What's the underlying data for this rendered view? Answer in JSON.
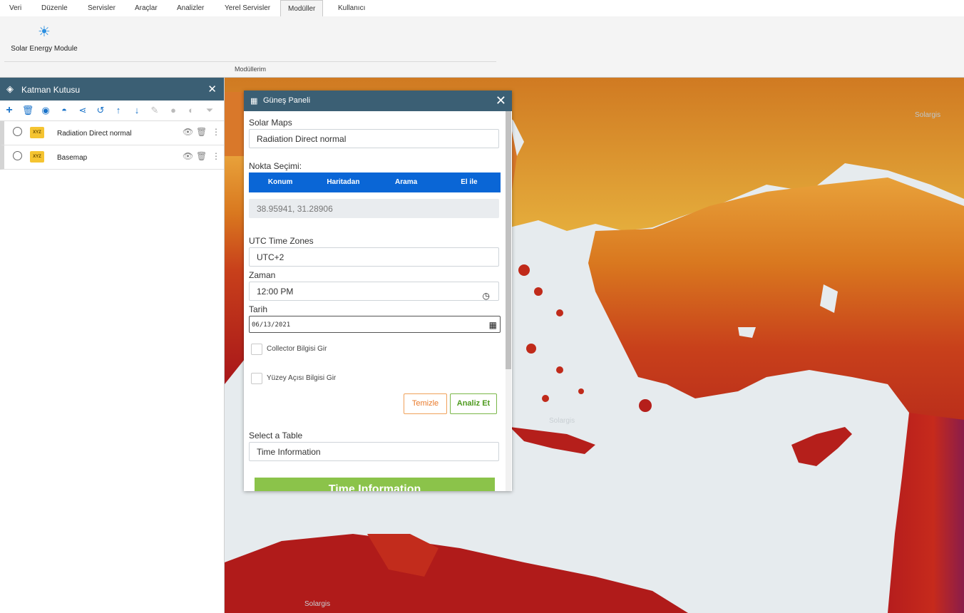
{
  "ribbon": {
    "tabs": [
      "Veri",
      "Düzenle",
      "Servisler",
      "Araçlar",
      "Analizler",
      "Yerel Servisler",
      "Modüller",
      "Kullanıcı"
    ],
    "active_tab": "Modüller",
    "module_button": {
      "icon": "sun-icon",
      "label": "Solar Energy Module"
    },
    "group_label": "Modüllerim"
  },
  "map": {
    "watermarks": [
      "Solargis",
      "Solargis",
      "Solargis"
    ]
  },
  "layer_panel": {
    "title": "Katman Kutusu",
    "toolbar_icons": [
      "add-icon",
      "delete-icon",
      "eye-icon",
      "hide-icon",
      "share-icon",
      "refresh-icon",
      "arrow-up-icon",
      "arrow-down-icon",
      "pencil-icon",
      "drop-icon",
      "palette-icon",
      "filter-icon"
    ],
    "layers": [
      {
        "badge": "XYZ",
        "name": "Radiation Direct normal"
      },
      {
        "badge": "XYZ",
        "name": "Basemap"
      }
    ]
  },
  "sun_panel": {
    "title": "Güneş Paneli",
    "solar_maps_label": "Solar Maps",
    "solar_maps_value": "Radiation Direct normal",
    "point_selection_label": "Nokta Seçimi:",
    "point_tabs": [
      "Konum",
      "Haritadan",
      "Arama",
      "El ile"
    ],
    "coordinates": "38.95941, 31.28906",
    "utc_label": "UTC Time Zones",
    "utc_value": "UTC+2",
    "time_label": "Zaman",
    "time_value": "12:00 PM",
    "date_label": "Tarih",
    "date_value": "06/13/2021",
    "collector_label": "Collector Bilgisi Gir",
    "surface_label": "Yüzey Açısı Bilgisi Gir",
    "clear_button": "Temizle",
    "analyze_button": "Analiz Et",
    "table_label": "Select a Table",
    "table_value": "Time Information",
    "table_button": "Time Information"
  }
}
